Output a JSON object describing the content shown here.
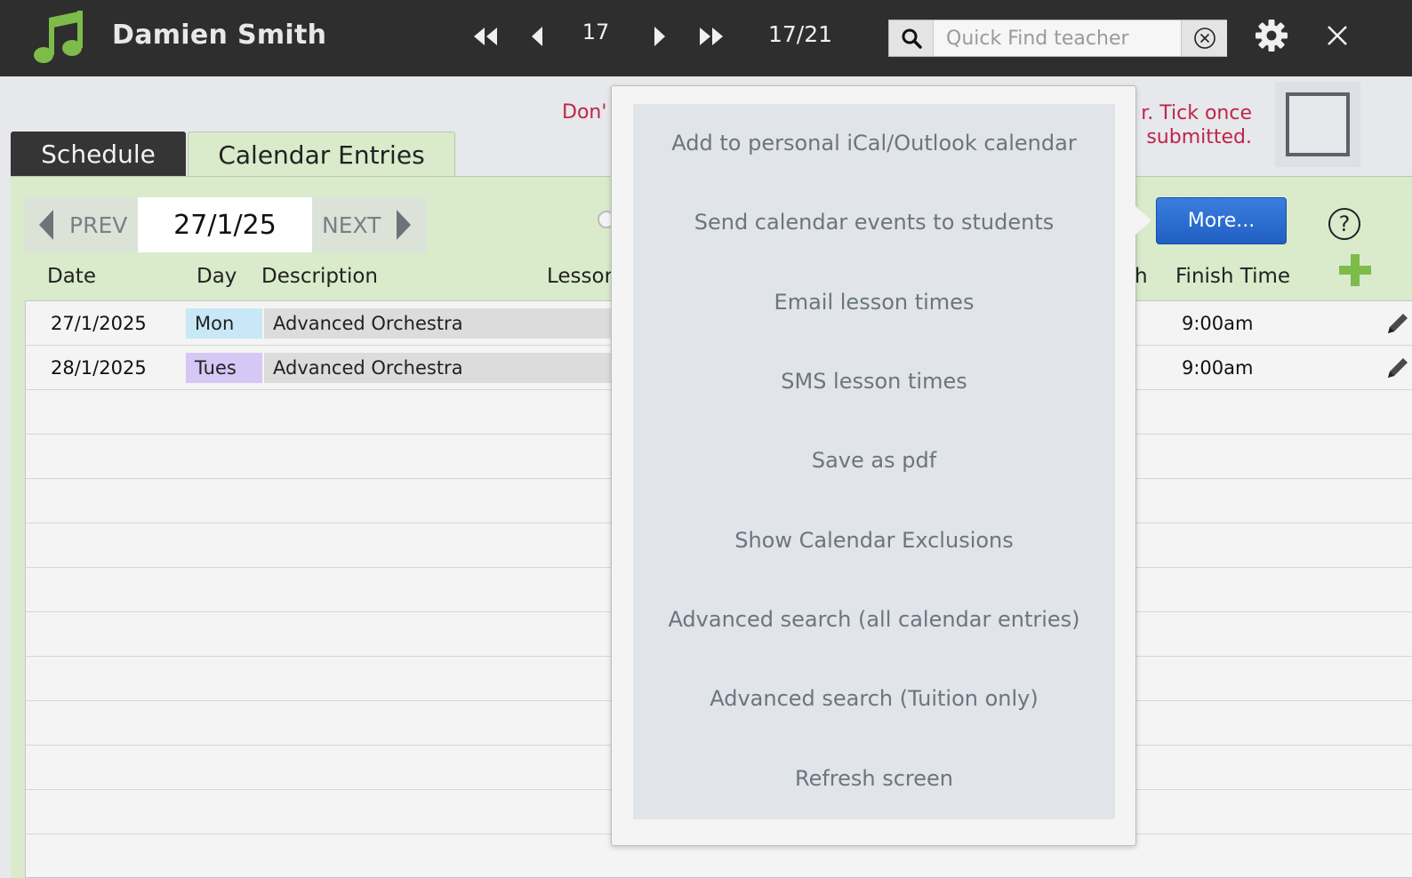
{
  "header": {
    "teacher_name": "Damien Smith",
    "record_number": "17",
    "record_count": "17/21",
    "search_placeholder": "Quick Find teacher",
    "logo_color": "#7dbb4a",
    "background": "#2e2e2e"
  },
  "warning": {
    "left_fragment": "Don'",
    "right_fragment": "r. Tick once submitted.",
    "color": "#c0244a"
  },
  "tabs": [
    {
      "label": "Schedule",
      "active": false
    },
    {
      "label": "Calendar Entries",
      "active": true
    }
  ],
  "navigation": {
    "prev_label": "PREV",
    "next_label": "NEXT",
    "current_date": "27/1/25"
  },
  "toolbar": {
    "more_label": "More...",
    "help_label": "?"
  },
  "columns": {
    "date": "Date",
    "day": "Day",
    "description": "Description",
    "lesson": "Lessor",
    "finish_partial": "h",
    "finish_time": "Finish Time"
  },
  "rows": [
    {
      "date": "27/1/2025",
      "day": "Mon",
      "day_color": "#c9e8f7",
      "description": "Advanced Orchestra",
      "finish": "9:00am"
    },
    {
      "date": "28/1/2025",
      "day": "Tues",
      "day_color": "#d5c8f4",
      "description": "Advanced Orchestra",
      "finish": "9:00am"
    }
  ],
  "menu": {
    "items": [
      "Add to personal iCal/Outlook calendar",
      "Send calendar events to students",
      "Email lesson times",
      "SMS lesson times",
      "Save as pdf",
      "Show Calendar Exclusions",
      "Advanced search (all calendar entries)",
      "Advanced search (Tuition only)",
      "Refresh screen"
    ]
  },
  "icons": {
    "logo": "music-note-icon",
    "first": "first-record-icon",
    "prev": "previous-record-icon",
    "next": "next-record-icon",
    "last": "last-record-icon",
    "search": "search-icon",
    "clear": "clear-search-icon",
    "settings": "gear-icon",
    "close": "close-icon",
    "add": "add-entry-icon",
    "edit": "pencil-icon"
  },
  "colors": {
    "panel": "#d9ebcb",
    "accent_blue": "#2a6fd6",
    "add_green": "#7dbb4a"
  }
}
